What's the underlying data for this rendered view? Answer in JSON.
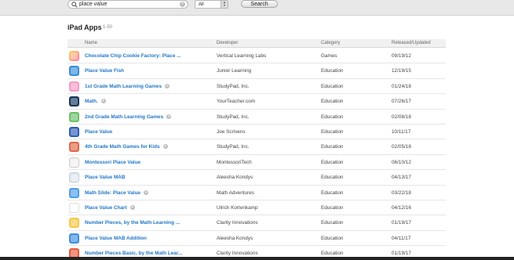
{
  "search": {
    "value": "place value",
    "clear_icon": "clear-icon",
    "search_icon": "magnifier-icon"
  },
  "filter": {
    "selected": "All"
  },
  "search_button": {
    "label": "Search"
  },
  "section": {
    "title": "iPad Apps",
    "range": "1-50"
  },
  "table": {
    "headers": {
      "name": "Name",
      "developer": "Developer",
      "category": "Category",
      "released": "Released/Updated"
    },
    "rows": [
      {
        "name": "Chocolate Chip Cookie Factory: Place ...",
        "plus": false,
        "developer": "Vertical Learning Labs",
        "category": "Games",
        "released": "09/19/12"
      },
      {
        "name": "Place Value Fish",
        "plus": false,
        "developer": "Junior Learning",
        "category": "Education",
        "released": "12/19/15"
      },
      {
        "name": "1st Grade Math Learning Games",
        "plus": true,
        "developer": "StudyPad, Inc.",
        "category": "Education",
        "released": "01/24/18"
      },
      {
        "name": "Math.",
        "plus": true,
        "developer": "YourTeacher.com",
        "category": "Education",
        "released": "07/26/17"
      },
      {
        "name": "2nd Grade Math Learning Games",
        "plus": true,
        "developer": "StudyPad, Inc.",
        "category": "Education",
        "released": "02/08/18"
      },
      {
        "name": "Place Value",
        "plus": false,
        "developer": "Joe Scrivens",
        "category": "Education",
        "released": "10/11/17"
      },
      {
        "name": "4th Grade Math Games for Kids",
        "plus": true,
        "developer": "StudyPad, Inc.",
        "category": "Education",
        "released": "02/05/18"
      },
      {
        "name": "Montessori Place Value",
        "plus": false,
        "developer": "MontessoriTech",
        "category": "Education",
        "released": "06/10/12"
      },
      {
        "name": "Place Value MAB",
        "plus": false,
        "developer": "Aleesha Kondys",
        "category": "Education",
        "released": "04/13/17"
      },
      {
        "name": "Math Slide: Place Value",
        "plus": true,
        "developer": "Math Adventures",
        "category": "Education",
        "released": "03/22/18"
      },
      {
        "name": "Place Value Chart",
        "plus": true,
        "developer": "Ulrich Kortenkamp",
        "category": "Education",
        "released": "04/12/16"
      },
      {
        "name": "Number Pieces, by the Math Learning ...",
        "plus": false,
        "developer": "Clarity Innovations",
        "category": "Education",
        "released": "01/19/17"
      },
      {
        "name": "Place Value MAB Addition",
        "plus": false,
        "developer": "Aleesha Kondys",
        "category": "Education",
        "released": "04/11/17"
      },
      {
        "name": "Number Pieces Basic, by the Math Lear...",
        "plus": false,
        "developer": "Clarity Innovations",
        "category": "Education",
        "released": "01/19/17"
      }
    ]
  }
}
